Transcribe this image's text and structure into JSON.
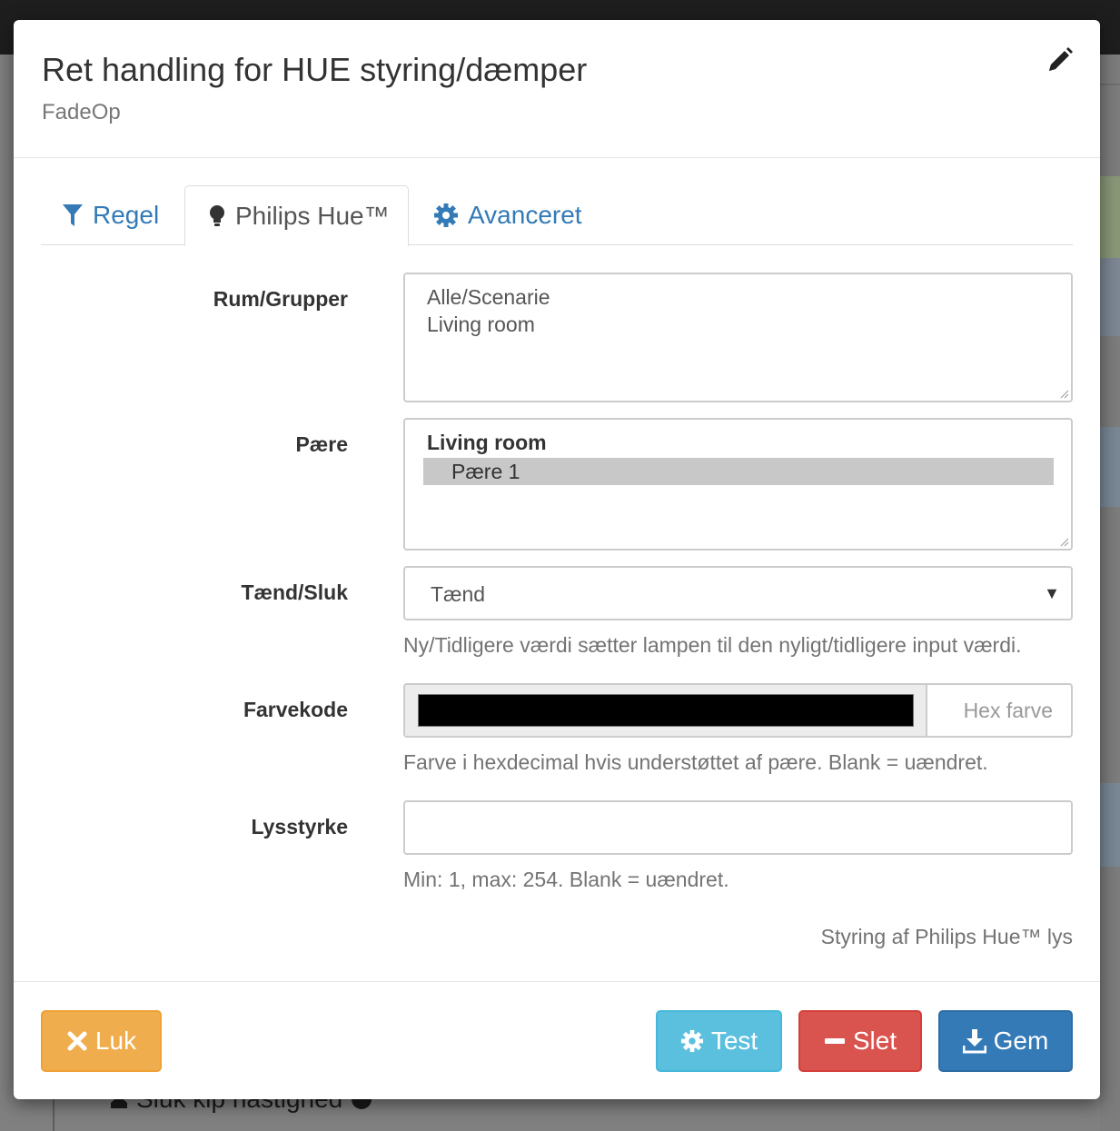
{
  "background": {
    "bottom_text": "Sluk kip hastighed"
  },
  "modal": {
    "title": "Ret handling for HUE styring/dæmper",
    "subtitle": "FadeOp",
    "edit_icon": "pencil-icon"
  },
  "tabs": [
    {
      "label": "Regel",
      "icon": "filter-icon",
      "active": false
    },
    {
      "label": "Philips Hue™",
      "icon": "lightbulb-icon",
      "active": true
    },
    {
      "label": "Avanceret",
      "icon": "gear-icon",
      "active": false
    }
  ],
  "form": {
    "rooms": {
      "label": "Rum/Grupper",
      "options": [
        "Alle/Scenarie",
        "Living room"
      ]
    },
    "bulb": {
      "label": "Pære",
      "group": "Living room",
      "selected_option": "Pære 1"
    },
    "onoff": {
      "label": "Tænd/Sluk",
      "value": "Tænd",
      "help": "Ny/Tidligere værdi sætter lampen til den nyligt/tidligere input værdi."
    },
    "color": {
      "label": "Farvekode",
      "swatch_color": "#000000",
      "addon": "Hex farve",
      "help": "Farve i hexdecimal hvis understøttet af pære. Blank = uændret."
    },
    "brightness": {
      "label": "Lysstyrke",
      "value": "",
      "help": "Min: 1, max: 254. Blank = uændret."
    },
    "footnote": "Styring af Philips Hue™ lys"
  },
  "footer": {
    "close_label": "Luk",
    "test_label": "Test",
    "delete_label": "Slet",
    "save_label": "Gem"
  },
  "colors": {
    "link": "#337ab7",
    "warning": "#f0ad4e",
    "info": "#5bc0de",
    "danger": "#d9534f",
    "primary": "#337ab7"
  }
}
